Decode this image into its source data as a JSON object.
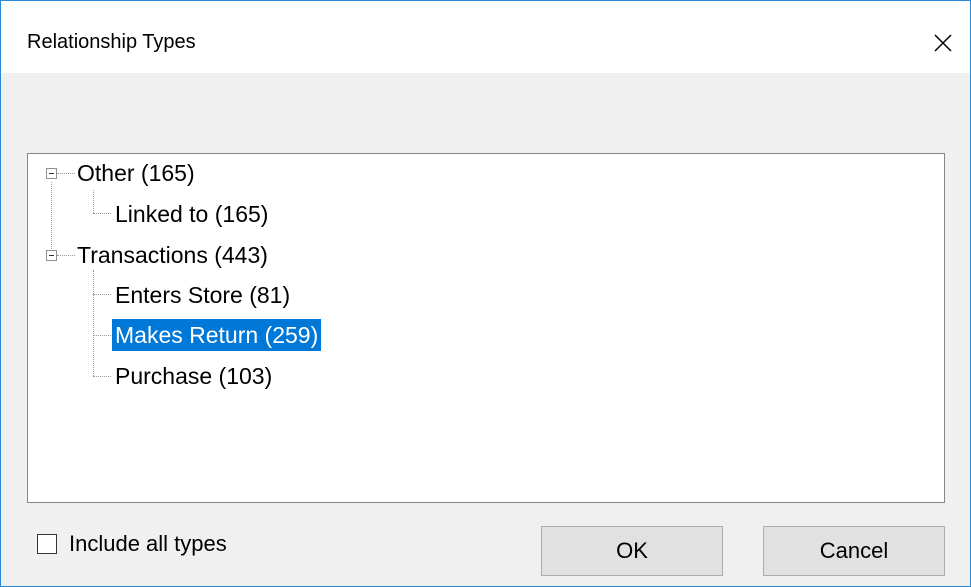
{
  "dialog": {
    "title": "Relationship Types",
    "close_icon": "close-icon"
  },
  "tree": {
    "groups": [
      {
        "label": "Other (165)",
        "expanded": true,
        "children": [
          {
            "label": "Linked to (165)",
            "selected": false
          }
        ]
      },
      {
        "label": "Transactions (443)",
        "expanded": true,
        "children": [
          {
            "label": "Enters Store (81)",
            "selected": false
          },
          {
            "label": "Makes Return (259)",
            "selected": true
          },
          {
            "label": "Purchase (103)",
            "selected": false
          }
        ]
      }
    ]
  },
  "options": {
    "include_all_label": "Include all types",
    "include_all_checked": false
  },
  "buttons": {
    "ok_label": "OK",
    "cancel_label": "Cancel"
  },
  "colors": {
    "selection": "#0078d7",
    "window_border": "#2b88d8"
  }
}
